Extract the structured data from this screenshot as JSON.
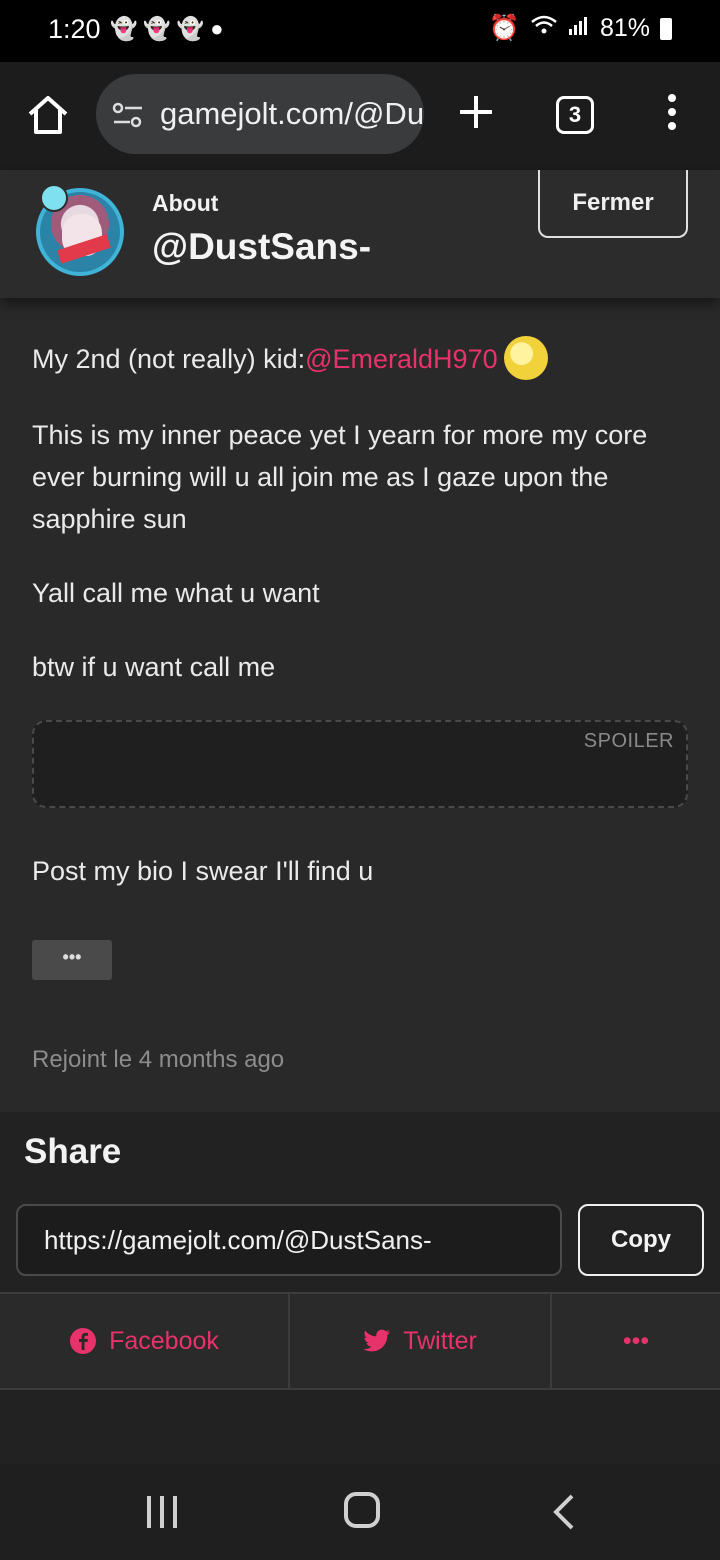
{
  "status_bar": {
    "time": "1:20",
    "battery": "81%"
  },
  "browser": {
    "url": "gamejolt.com/@DustSans-",
    "tab_count": "3"
  },
  "about": {
    "label": "About",
    "username": "@DustSans-",
    "close_label": "Fermer"
  },
  "bio": {
    "kid_prefix": "My 2nd (not really) kid:",
    "kid_mention": "@EmeraldH970",
    "line_peace": "This is my inner peace yet I yearn for more my core ever burning will u all join me as I gaze upon the sapphire sun",
    "line_call": "Yall call me what u want",
    "line_btw": "btw if u want call me",
    "spoiler_label": "SPOILER",
    "line_post": "Post my bio I swear I'll find u",
    "more_label": "•••",
    "joined": "Rejoint le 4 months ago"
  },
  "share": {
    "title": "Share",
    "url": "https://gamejolt.com/@DustSans-",
    "copy_label": "Copy",
    "facebook_label": "Facebook",
    "twitter_label": "Twitter",
    "more_label": "•••",
    "accent_color": "#e8326b"
  }
}
